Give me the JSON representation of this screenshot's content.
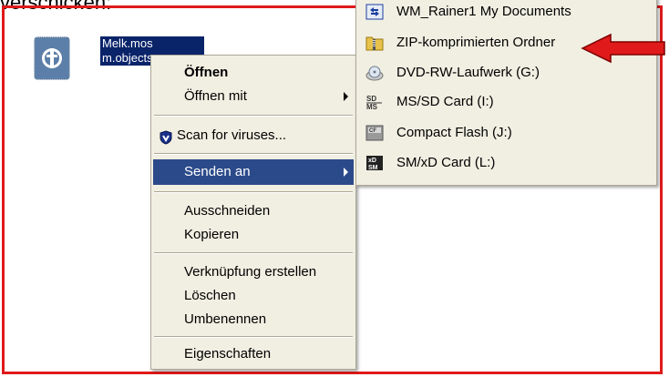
{
  "caption": "verschicken:",
  "file": {
    "name_line1": "Melk.mos",
    "name_line2": "m.objectsp",
    "icon": "mos-file-icon"
  },
  "context_menu": {
    "items": [
      {
        "label": "Öffnen",
        "bold": true
      },
      {
        "label": "Öffnen mit",
        "submenu": true
      },
      {
        "label": "Scan for viruses...",
        "icon": "shield-icon"
      },
      {
        "label": "Senden an",
        "submenu": true,
        "highlighted": true
      },
      {
        "label": "Ausschneiden"
      },
      {
        "label": "Kopieren"
      },
      {
        "label": "Verknüpfung erstellen"
      },
      {
        "label": "Löschen"
      },
      {
        "label": "Umbenennen"
      },
      {
        "label": "Eigenschaften"
      }
    ]
  },
  "send_to_menu": {
    "items": [
      {
        "label": "WM_Rainer1 My Documents",
        "icon": "sync-icon"
      },
      {
        "label": "ZIP-komprimierten Ordner",
        "icon": "zip-folder-icon"
      },
      {
        "label": "DVD-RW-Laufwerk (G:)",
        "icon": "dvd-drive-icon"
      },
      {
        "label": "MS/SD Card (I:)",
        "icon": "sd-card-icon"
      },
      {
        "label": "Compact Flash (J:)",
        "icon": "compact-flash-icon"
      },
      {
        "label": "SM/xD Card (L:)",
        "icon": "xd-card-icon"
      }
    ]
  },
  "colors": {
    "frame": "#e01a1a",
    "highlight": "#2b4a8a",
    "menu_bg": "#f1efe2",
    "pointer_arrow": "#e01a1a"
  }
}
